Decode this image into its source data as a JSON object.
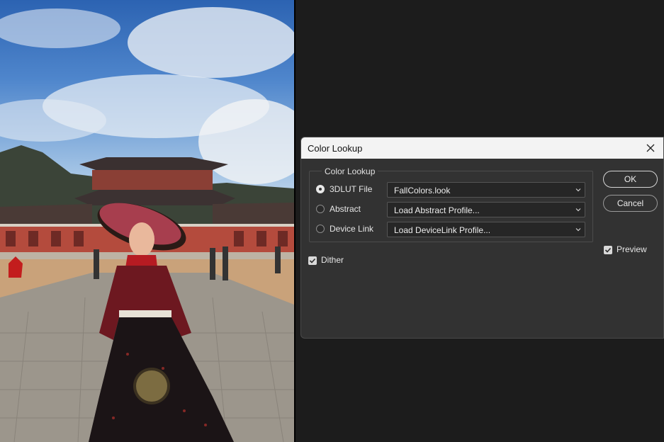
{
  "dialog": {
    "title": "Color Lookup",
    "group_title": "Color Lookup",
    "options": [
      {
        "label": "3DLUT File",
        "selected": true,
        "value": "FallColors.look"
      },
      {
        "label": "Abstract",
        "selected": false,
        "value": "Load Abstract Profile..."
      },
      {
        "label": "Device Link",
        "selected": false,
        "value": "Load DeviceLink Profile..."
      }
    ],
    "dither_label": "Dither",
    "dither_checked": true,
    "ok_label": "OK",
    "cancel_label": "Cancel",
    "preview_label": "Preview",
    "preview_checked": true
  },
  "colors": {
    "canvas_bg": "#1c1c1c",
    "dialog_bg": "#323232",
    "titlebar_bg": "#f3f3f3"
  },
  "icons": {
    "close": "close-icon",
    "dropdown": "chevron-down-icon",
    "check": "checkmark-icon"
  }
}
